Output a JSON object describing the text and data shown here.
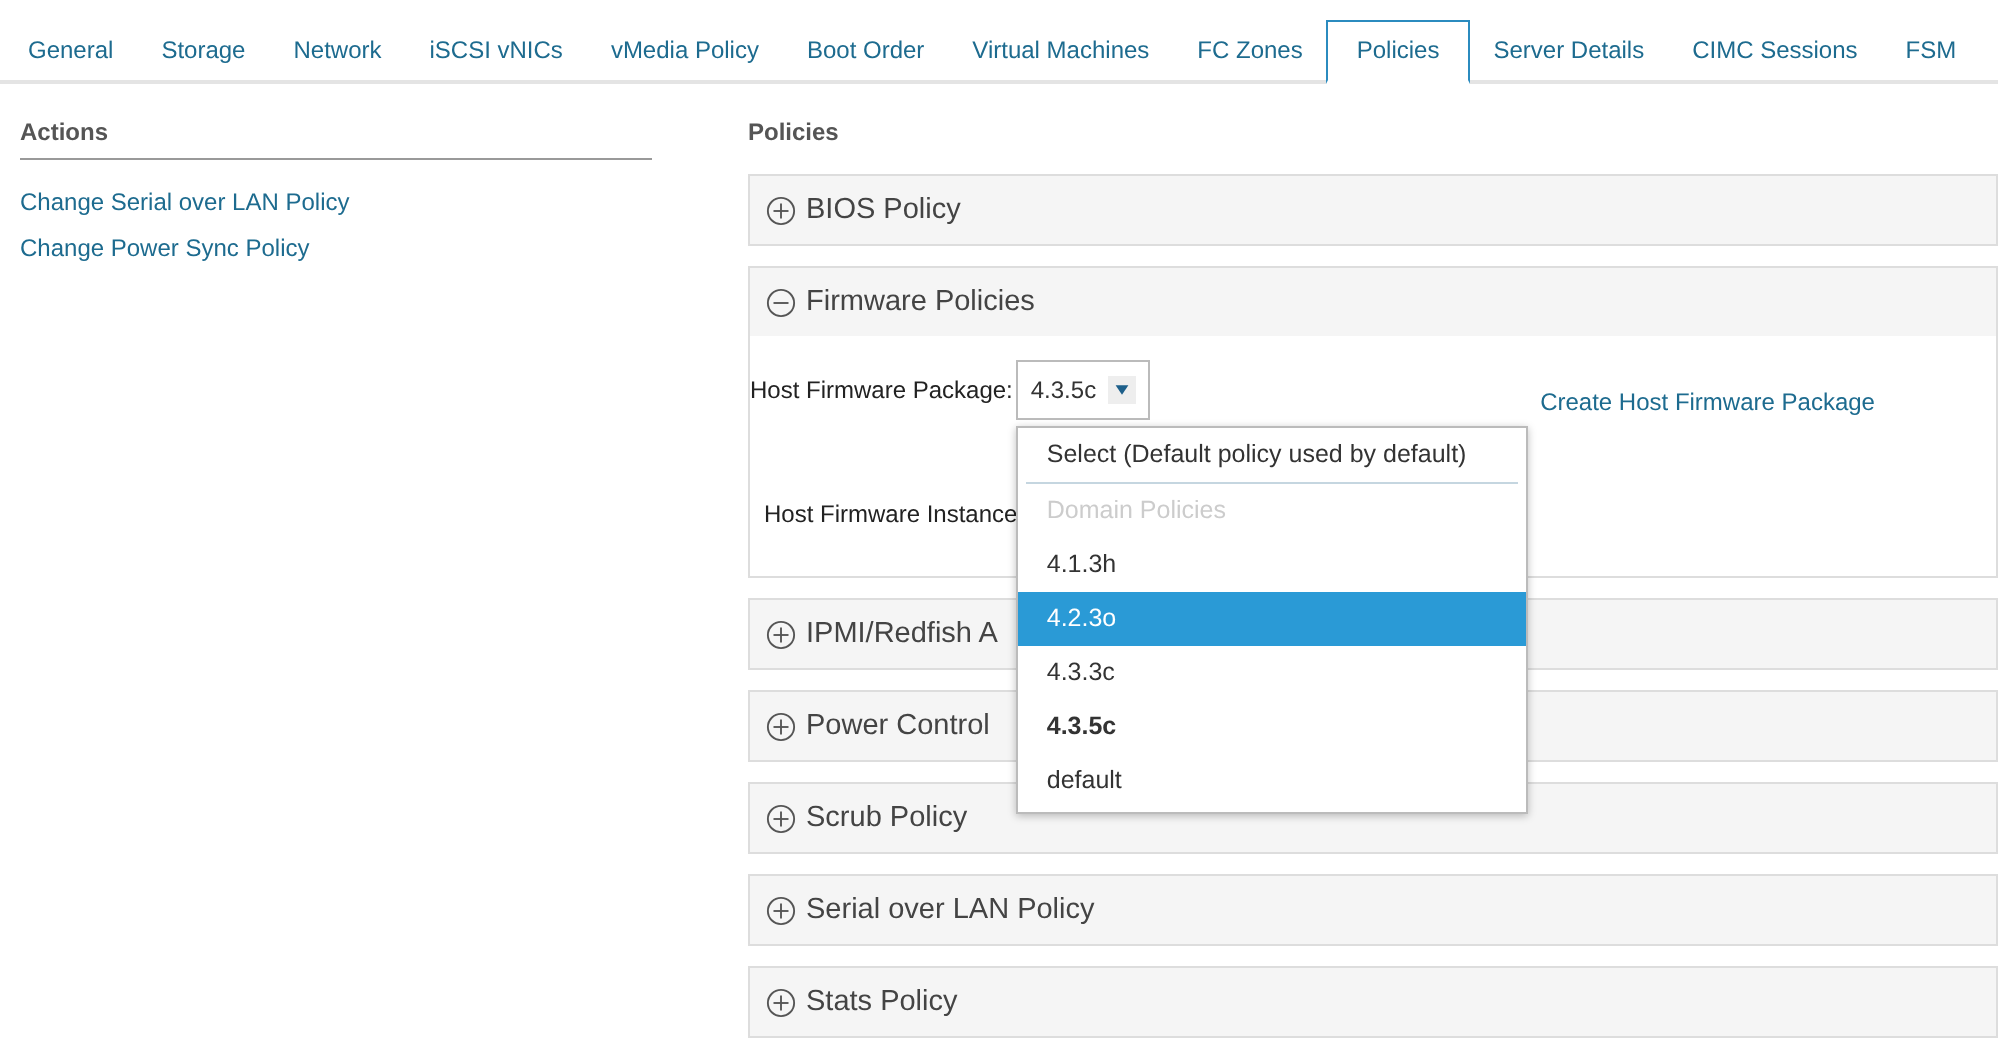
{
  "tabs": [
    {
      "label": "General",
      "selected": false
    },
    {
      "label": "Storage",
      "selected": false
    },
    {
      "label": "Network",
      "selected": false
    },
    {
      "label": "iSCSI vNICs",
      "selected": false
    },
    {
      "label": "vMedia Policy",
      "selected": false
    },
    {
      "label": "Boot Order",
      "selected": false
    },
    {
      "label": "Virtual Machines",
      "selected": false
    },
    {
      "label": "FC Zones",
      "selected": false
    },
    {
      "label": "Policies",
      "selected": true
    },
    {
      "label": "Server Details",
      "selected": false
    },
    {
      "label": "CIMC Sessions",
      "selected": false
    },
    {
      "label": "FSM",
      "selected": false
    }
  ],
  "actions": {
    "title": "Actions",
    "links": [
      "Change Serial over LAN Policy",
      "Change Power Sync Policy"
    ]
  },
  "policies": {
    "title": "Policies",
    "panels": [
      {
        "title": "BIOS Policy",
        "expanded": false
      },
      {
        "title": "Firmware Policies",
        "expanded": true,
        "package_label": "Host Firmware Package:",
        "package_value": "4.3.5c",
        "create_link": "Create Host Firmware Package",
        "instance_label": "Host Firmware Instance",
        "dropdown": [
          {
            "kind": "option",
            "label": "Select (Default policy used by default)",
            "selected": false,
            "current": false
          },
          {
            "kind": "group",
            "label": "Domain Policies"
          },
          {
            "kind": "option",
            "label": "4.1.3h",
            "selected": false,
            "current": false
          },
          {
            "kind": "option",
            "label": "4.2.3o",
            "selected": true,
            "current": false
          },
          {
            "kind": "option",
            "label": "4.3.3c",
            "selected": false,
            "current": false
          },
          {
            "kind": "option",
            "label": "4.3.5c",
            "selected": false,
            "current": true
          },
          {
            "kind": "option",
            "label": "default",
            "selected": false,
            "current": false
          }
        ]
      },
      {
        "title": "IPMI/Redfish A",
        "expanded": false
      },
      {
        "title": "Power Control",
        "expanded": false
      },
      {
        "title": "Scrub Policy",
        "expanded": false
      },
      {
        "title": "Serial over LAN Policy",
        "expanded": false
      },
      {
        "title": "Stats Policy",
        "expanded": false
      }
    ]
  }
}
